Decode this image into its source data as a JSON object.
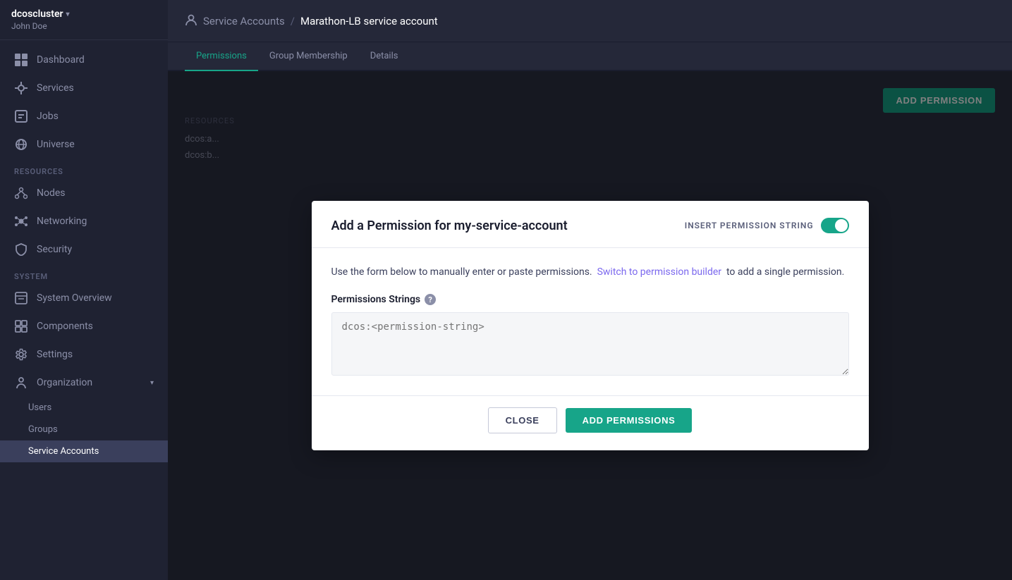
{
  "sidebar": {
    "cluster_name": "dcoscluster",
    "user_name": "John Doe",
    "nav_items": [
      {
        "id": "dashboard",
        "label": "Dashboard",
        "icon": "dashboard"
      },
      {
        "id": "services",
        "label": "Services",
        "icon": "services"
      },
      {
        "id": "jobs",
        "label": "Jobs",
        "icon": "jobs"
      },
      {
        "id": "universe",
        "label": "Universe",
        "icon": "universe"
      }
    ],
    "resources_label": "RESOURCES",
    "resources_items": [
      {
        "id": "nodes",
        "label": "Nodes",
        "icon": "nodes"
      },
      {
        "id": "networking",
        "label": "Networking",
        "icon": "networking"
      },
      {
        "id": "security",
        "label": "Security",
        "icon": "security"
      }
    ],
    "system_label": "SYSTEM",
    "system_items": [
      {
        "id": "system-overview",
        "label": "System Overview",
        "icon": "system"
      },
      {
        "id": "components",
        "label": "Components",
        "icon": "components"
      },
      {
        "id": "settings",
        "label": "Settings",
        "icon": "settings"
      },
      {
        "id": "organization",
        "label": "Organization",
        "icon": "org",
        "has_caret": true
      }
    ],
    "org_sub_items": [
      {
        "id": "users",
        "label": "Users"
      },
      {
        "id": "groups",
        "label": "Groups"
      },
      {
        "id": "service-accounts",
        "label": "Service Accounts",
        "active": true
      }
    ]
  },
  "breadcrumb": {
    "icon": "person-icon",
    "parent": "Service Accounts",
    "separator": "/",
    "current": "Marathon-LB service account"
  },
  "tabs": [
    {
      "id": "permissions",
      "label": "Permissions",
      "active": true
    },
    {
      "id": "group-membership",
      "label": "Group Membership",
      "active": false
    },
    {
      "id": "details",
      "label": "Details",
      "active": false
    }
  ],
  "add_permission_button": "ADD PERMISSION",
  "resource_section": {
    "label": "RESOURCES",
    "rows": [
      "dcos:a...",
      "dcos:b..."
    ]
  },
  "modal": {
    "title": "Add a Permission for my-service-account",
    "toggle_label": "INSERT PERMISSION STRING",
    "toggle_on": true,
    "description_prefix": "Use the form below to manually enter or paste permissions.",
    "description_link": "Switch to permission builder",
    "description_suffix": "to add a single permission.",
    "permission_strings_label": "Permissions Strings",
    "help_icon": "?",
    "textarea_placeholder": "dcos:<permission-string>",
    "close_button": "CLOSE",
    "add_button": "ADD  PERMISSIONS"
  }
}
